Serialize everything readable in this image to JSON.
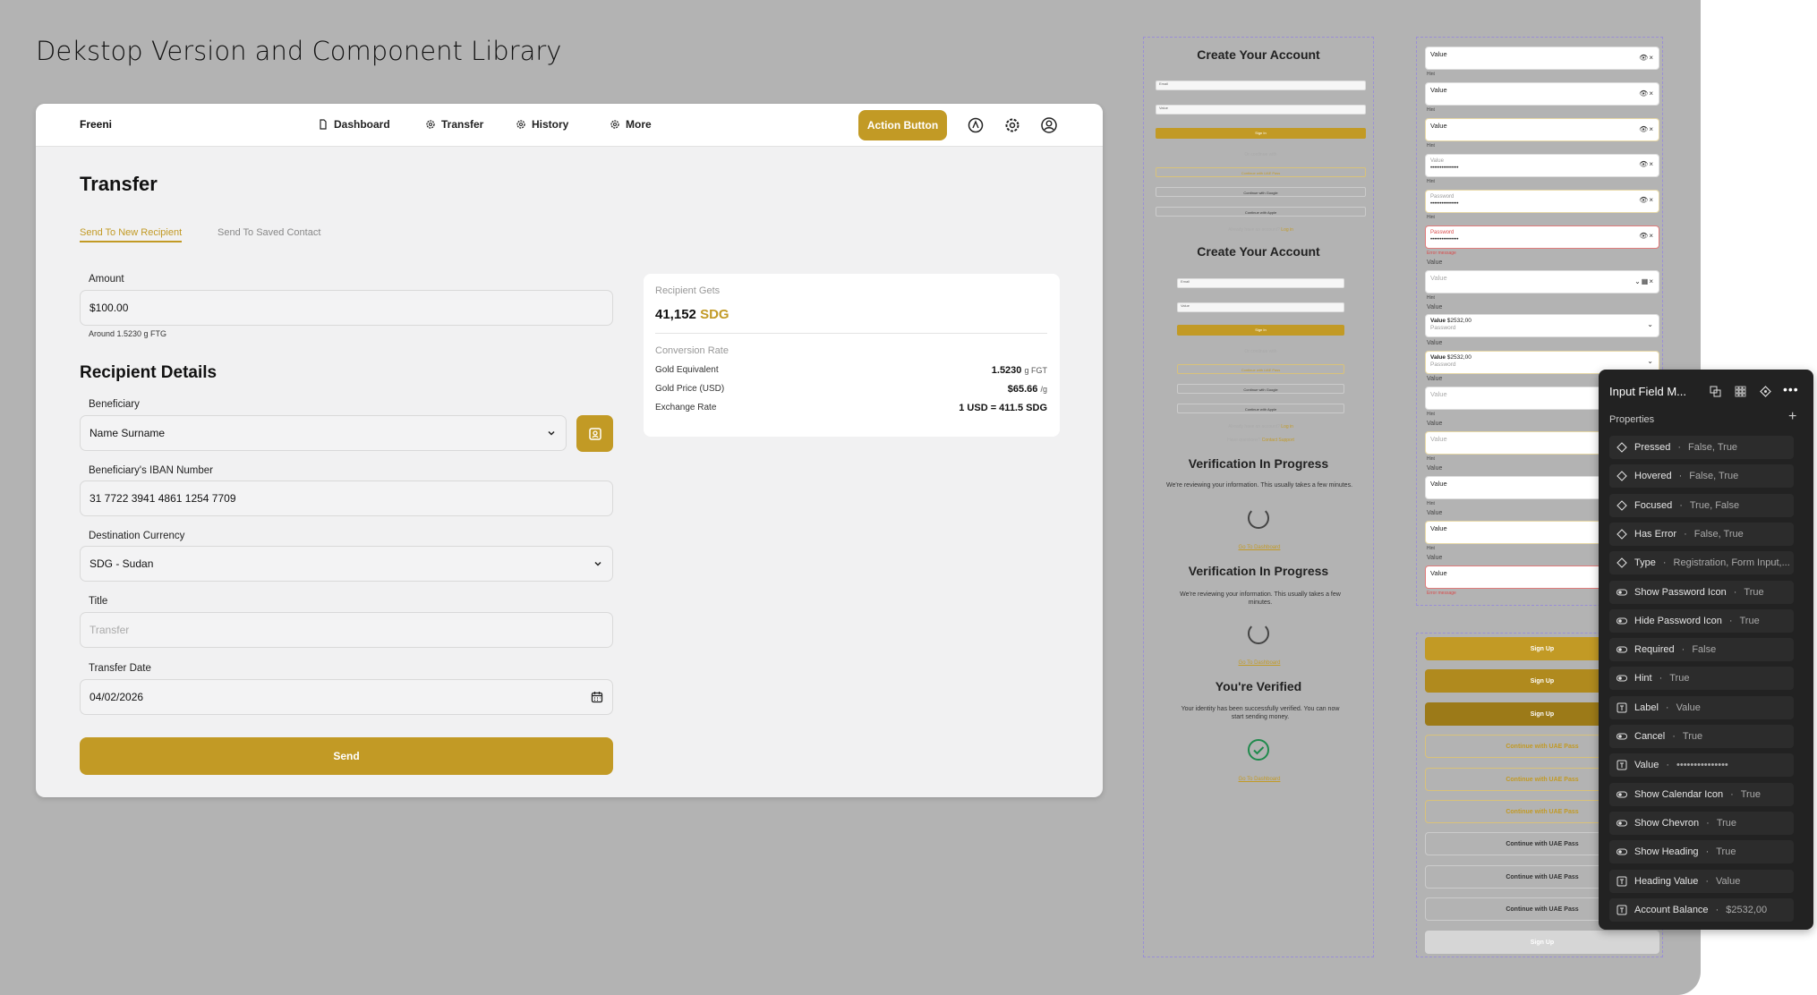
{
  "page_title": "Dekstop Version and Component Library",
  "nav": {
    "brand": "Freeni",
    "items": [
      "Dashboard",
      "Transfer",
      "History",
      "More"
    ],
    "action_button": "Action Button"
  },
  "transfer": {
    "heading": "Transfer",
    "tabs": [
      "Send To New Recipient",
      "Send To Saved Contact"
    ],
    "amount_label": "Amount",
    "amount_value": "$100.00",
    "amount_hint": "Around 1.5230 g FTG",
    "recipient_heading": "Recipient Details",
    "beneficiary_label": "Beneficiary",
    "beneficiary_value": "Name Surname",
    "iban_label": "Beneficiary's IBAN Number",
    "iban_value": "31 7722 3941 4861 1254 7709",
    "currency_label": "Destination Currency",
    "currency_value": "SDG - Sudan",
    "title_label": "Title",
    "title_placeholder": "Transfer",
    "date_label": "Transfer Date",
    "date_value": "04/02/2026",
    "send_button": "Send"
  },
  "summary": {
    "recipient_gets_label": "Recipient Gets",
    "recipient_gets_amount": "41,152",
    "recipient_gets_currency": "SDG",
    "conversion_label": "Conversion Rate",
    "rows": [
      {
        "label": "Gold Equivalent",
        "value": "1.5230",
        "unit": "g FGT"
      },
      {
        "label": "Gold Price (USD)",
        "value": "$65.66",
        "unit": "/g"
      },
      {
        "label": "Exchange Rate",
        "value": "1 USD = 411.5 SDG",
        "unit": ""
      }
    ]
  },
  "mockups": {
    "create_account": "Create Your Account",
    "email": "Email",
    "value": "Value",
    "sign_in": "Sign In",
    "or_continue": "Or continue with",
    "continue_uae": "Continue with UAE Pass",
    "continue_google": "Continue with Google",
    "continue_apple": "Continue with Apple",
    "already": "Already have an account?",
    "log_in": "Log in",
    "questions": "Have questions?",
    "contact": "Contact Support",
    "verification": "Verification In Progress",
    "verification_body": "We're reviewing your information. This usually takes a few minutes.",
    "go_dashboard": "Go To Dashboard",
    "verified": "You're Verified",
    "verified_body": "Your identity has been successfully verified. You can now start sending money."
  },
  "input_variants": {
    "value": "Value",
    "hint": "Hint",
    "password": "Password",
    "masked": "•••••••••••••••",
    "error_message": "Error message",
    "balance": "$2532,00",
    "sign_up": "Sign Up",
    "continue_uae": "Continue with UAE Pass"
  },
  "panel": {
    "title": "Input Field M...",
    "section": "Properties",
    "props": [
      {
        "icon": "diamond",
        "name": "Pressed",
        "value": "False, True"
      },
      {
        "icon": "diamond",
        "name": "Hovered",
        "value": "False, True"
      },
      {
        "icon": "diamond",
        "name": "Focused",
        "value": "True, False"
      },
      {
        "icon": "diamond",
        "name": "Has Error",
        "value": "False, True"
      },
      {
        "icon": "diamond",
        "name": "Type",
        "value": "Registration, Form Input,..."
      },
      {
        "icon": "toggle",
        "name": "Show Password Icon",
        "value": "True"
      },
      {
        "icon": "toggle",
        "name": "Hide Password Icon",
        "value": "True"
      },
      {
        "icon": "toggle",
        "name": "Required",
        "value": "False"
      },
      {
        "icon": "toggle",
        "name": "Hint",
        "value": "True"
      },
      {
        "icon": "text",
        "name": "Label",
        "value": "Value"
      },
      {
        "icon": "toggle",
        "name": "Cancel",
        "value": "True"
      },
      {
        "icon": "text",
        "name": "Value",
        "value": "•••••••••••••••"
      },
      {
        "icon": "toggle",
        "name": "Show Calendar Icon",
        "value": "True"
      },
      {
        "icon": "toggle",
        "name": "Show Chevron",
        "value": "True"
      },
      {
        "icon": "toggle",
        "name": "Show Heading",
        "value": "True"
      },
      {
        "icon": "text",
        "name": "Heading Value",
        "value": "Value"
      },
      {
        "icon": "text",
        "name": "Account Balance",
        "value": "$2532,00"
      }
    ]
  },
  "colors": {
    "accent": "#c29a25",
    "canvas": "#b3b3b3",
    "panel": "#222222"
  }
}
